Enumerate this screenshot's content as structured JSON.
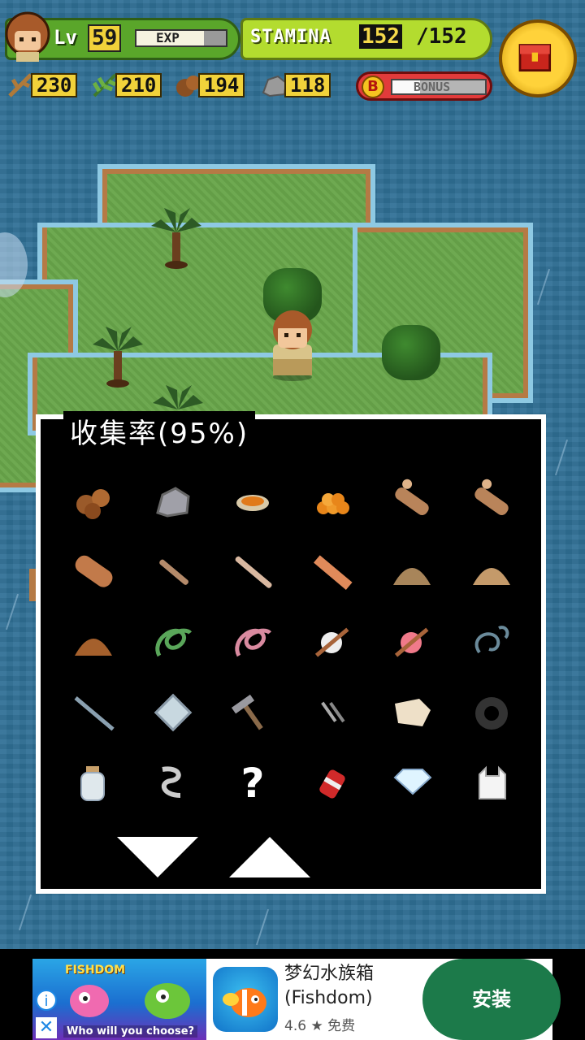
{
  "hud": {
    "level_label": "Lv",
    "level": "59",
    "exp_label": "EXP",
    "exp_progress": 0.75,
    "stamina_label": "STAMINA",
    "stamina_current": "152",
    "stamina_max": "/152",
    "resources": [
      {
        "icon": "branch-icon",
        "value": "230"
      },
      {
        "icon": "leaf-icon",
        "value": "210"
      },
      {
        "icon": "coconut-icon",
        "value": "194"
      },
      {
        "icon": "stone-icon",
        "value": "118"
      }
    ],
    "bonus_badge": "B",
    "bonus_label": "BONUS",
    "bonus_progress": 0.3
  },
  "panel": {
    "title": "收集率(95%)",
    "items": [
      "nuts-icon",
      "stone-icon",
      "bowl-icon",
      "orange-pile-icon",
      "log-icon",
      "log-icon",
      "thick-log-icon",
      "stick-icon",
      "long-stick-icon",
      "plank-icon",
      "dirt-pile-icon",
      "sand-pile-icon",
      "clay-pile-icon",
      "green-rope-icon",
      "pink-rope-icon",
      "white-thread-icon",
      "red-thread-icon",
      "wire-icon",
      "rod-icon",
      "glass-plate-icon",
      "hammer-icon",
      "nails-icon",
      "cloth-icon",
      "tire-icon",
      "bottle-icon",
      "chain-icon",
      "unknown-icon",
      "can-icon",
      "diamond-icon",
      "plastic-bag-icon"
    ],
    "unknown_symbol": "?",
    "down_label": "down",
    "up_label": "up"
  },
  "ad": {
    "brand": "FISHDOM",
    "caption": "Who will you choose?",
    "title_line1": "梦幻水族箱",
    "title_line2": "(Fishdom)",
    "rating": "4.6 ★ 免费",
    "install": "安装",
    "info_symbol": "i",
    "close_symbol": "✕"
  },
  "colors": {
    "ocean": "#2f6f95",
    "grass": "#69a64b",
    "hud_green": "#5aa62a",
    "stamina_lime": "#b3dc2f",
    "resource_yellow": "#f1d23a",
    "install_green": "#1c7a4a"
  }
}
